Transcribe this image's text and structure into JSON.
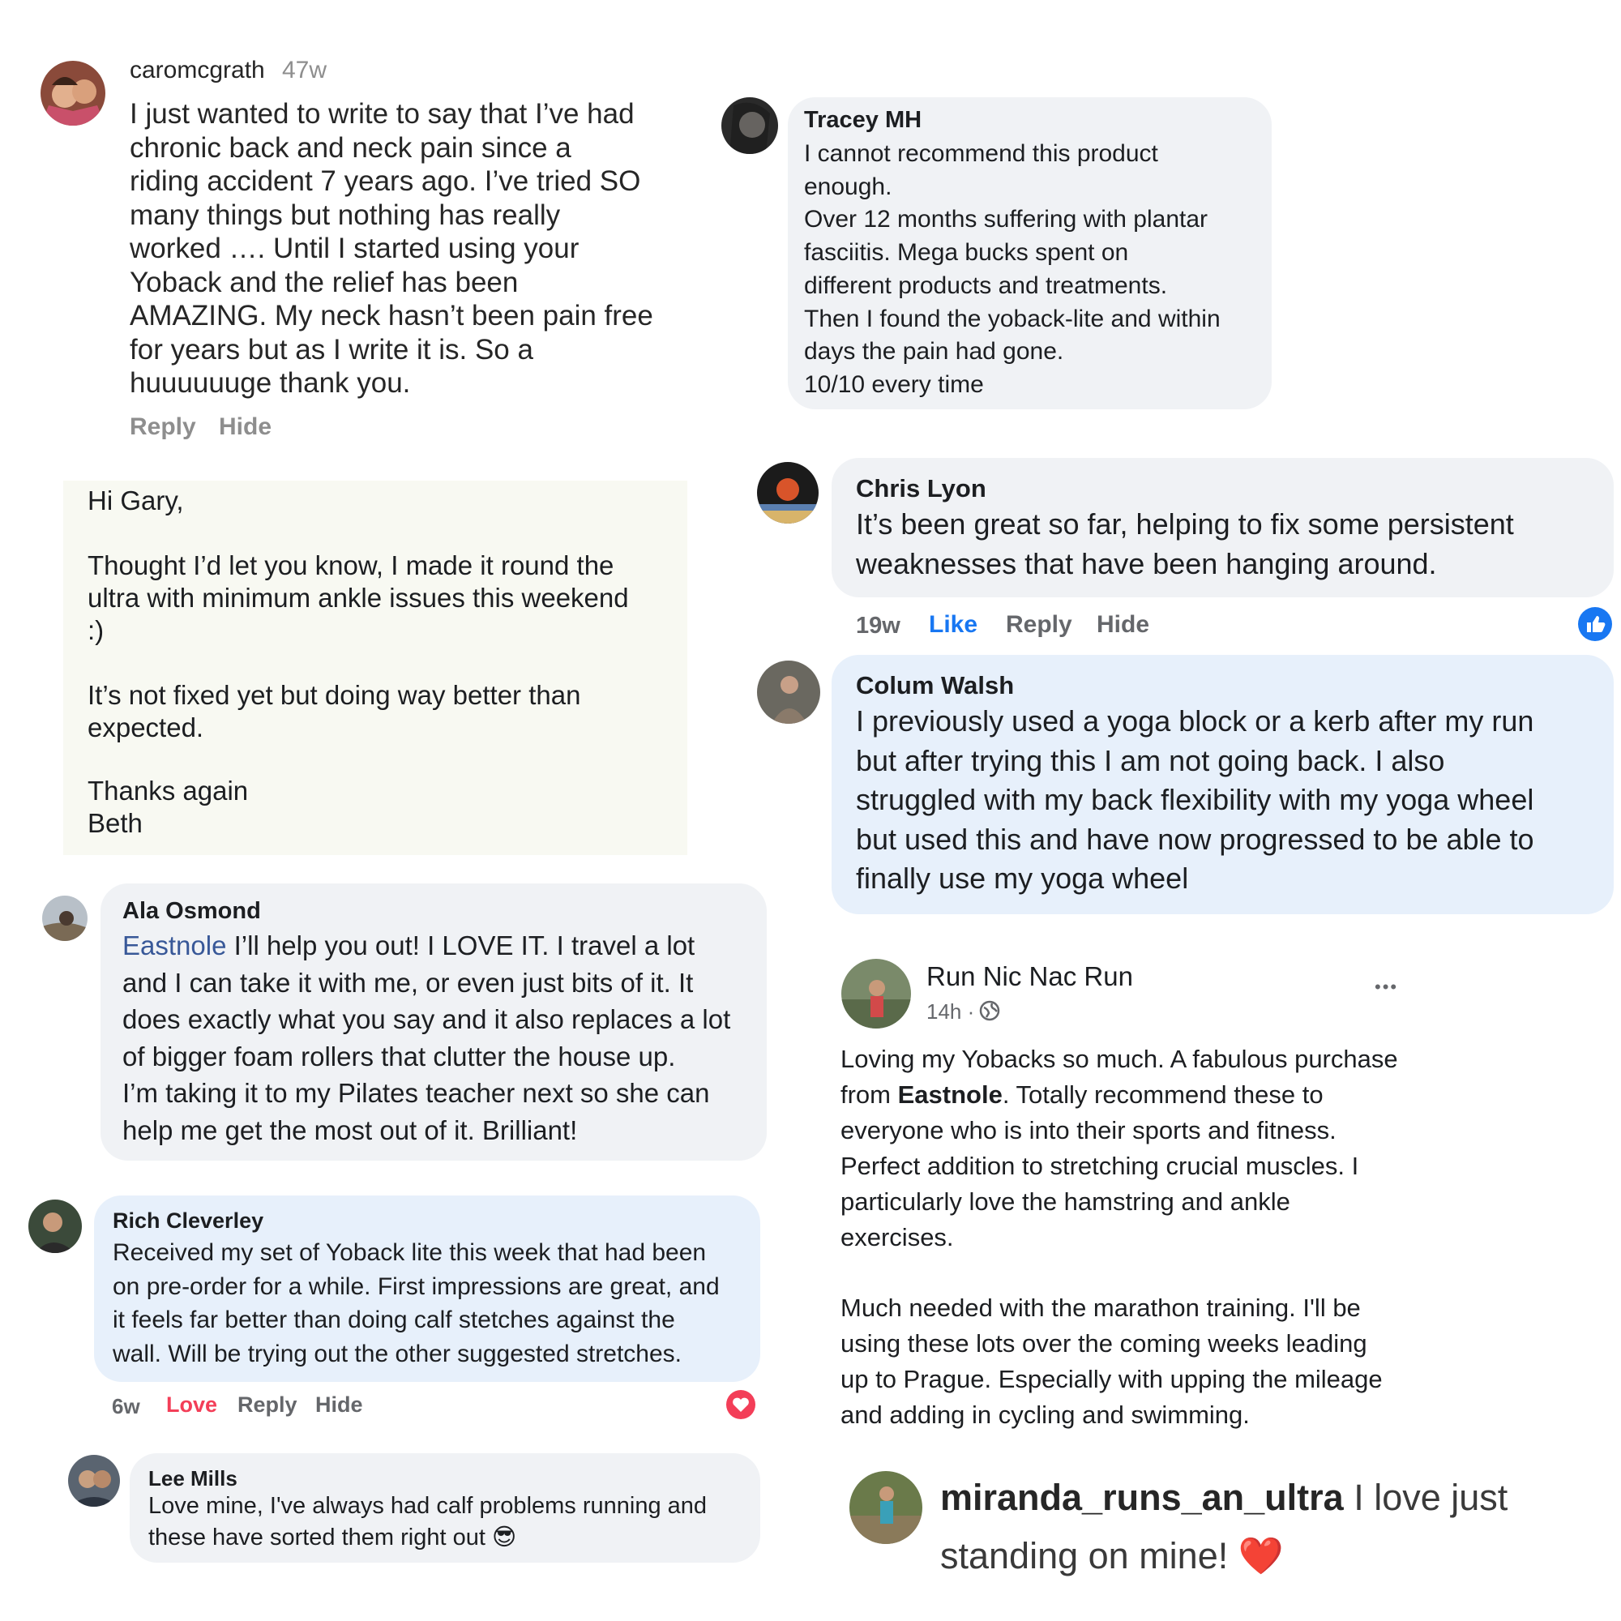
{
  "caro": {
    "username": "caromcgrath",
    "time": "47w",
    "text": "I just wanted to write to say that I’ve had\nchronic back and neck pain since a\nriding accident 7 years ago. I’ve tried SO\nmany things but nothing has really\nworked …. Until I started using your\nYoback and the relief has been\nAMAZING. My neck hasn’t been pain free\nfor  years but as I write it is. So a\nhuuuuuuge thank you.",
    "reply": "Reply",
    "hide": "Hide"
  },
  "email": {
    "greeting": "Hi Gary,",
    "p1": "Thought I’d let you know, I made it round the\nultra with minimum ankle issues this weekend\n:)",
    "p2": "It’s not fixed yet but doing way better than\nexpected.",
    "p3": "Thanks again\nBeth"
  },
  "ala": {
    "name": "Ala Osmond",
    "mention": "Eastnole",
    "text": " I’ll help you out! I LOVE IT. I travel a lot\nand I can take it with me, or even just bits of it. It\ndoes exactly what you say and it also replaces a lot\nof bigger foam rollers that clutter the house up.\nI’m taking it to my Pilates teacher next so she can\nhelp me get the most out of it. Brilliant!"
  },
  "rich": {
    "name": "Rich Cleverley",
    "text": "Received my set of Yoback lite this week that had been\non pre-order for a while. First impressions are great, and\nit feels far better than doing calf stetches against the\nwall. Will be trying out the other suggested stretches.",
    "time": "6w",
    "love": "Love",
    "reply": "Reply",
    "hide": "Hide"
  },
  "lee": {
    "name": "Lee Mills",
    "text": "Love mine, I've always had calf problems running and\nthese have sorted them right out",
    "emoji": "😎"
  },
  "tracey": {
    "name": "Tracey MH",
    "text": "I cannot recommend this product\nenough.\nOver 12 months suffering with plantar\nfasciitis. Mega bucks spent on\ndifferent products and treatments.\nThen I found the yoback-lite and within\ndays the pain had gone.\n10/10 every time"
  },
  "chris": {
    "name": "Chris Lyon",
    "text": "It’s been great so far, helping to fix some persistent\nweaknesses that have been hanging around.",
    "time": "19w",
    "like": "Like",
    "reply": "Reply",
    "hide": "Hide"
  },
  "colum": {
    "name": "Colum Walsh",
    "text": "I previously used a yoga block or a kerb after my run\nbut after trying this I am not going back. I also\nstruggled with my back flexibility with my yoga wheel\nbut used this and have now progressed to be able to\nfinally use my yoga wheel"
  },
  "run": {
    "name": "Run Nic Nac Run",
    "time": "14h ·",
    "dots": "•••",
    "t1": "Loving my Yobacks so much. A fabulous purchase\nfrom ",
    "brand": "Eastnole",
    "t2": ". Totally recommend these to\neveryone who is into their sports and fitness.\nPerfect addition to stretching crucial muscles. I\nparticularly love the hamstring and ankle\nexercises.",
    "t3": "Much needed with the marathon training. I'll be\nusing these lots over the coming weeks leading\nup to Prague. Especially with upping the mileage\nand adding in cycling and swimming."
  },
  "miranda": {
    "username": "miranda_runs_an_ultra",
    "text": " I love just",
    "text2": "standing on mine! ",
    "heart": "❤️"
  },
  "colors": {
    "meta_gray": "#65676b",
    "link_blue": "#385898",
    "like_blue": "#1877f2",
    "love_red": "#f33e58",
    "bubble_gray": "#f0f2f5",
    "bubble_blue": "#e7f0fb",
    "email_bg": "#f8f9f2"
  }
}
